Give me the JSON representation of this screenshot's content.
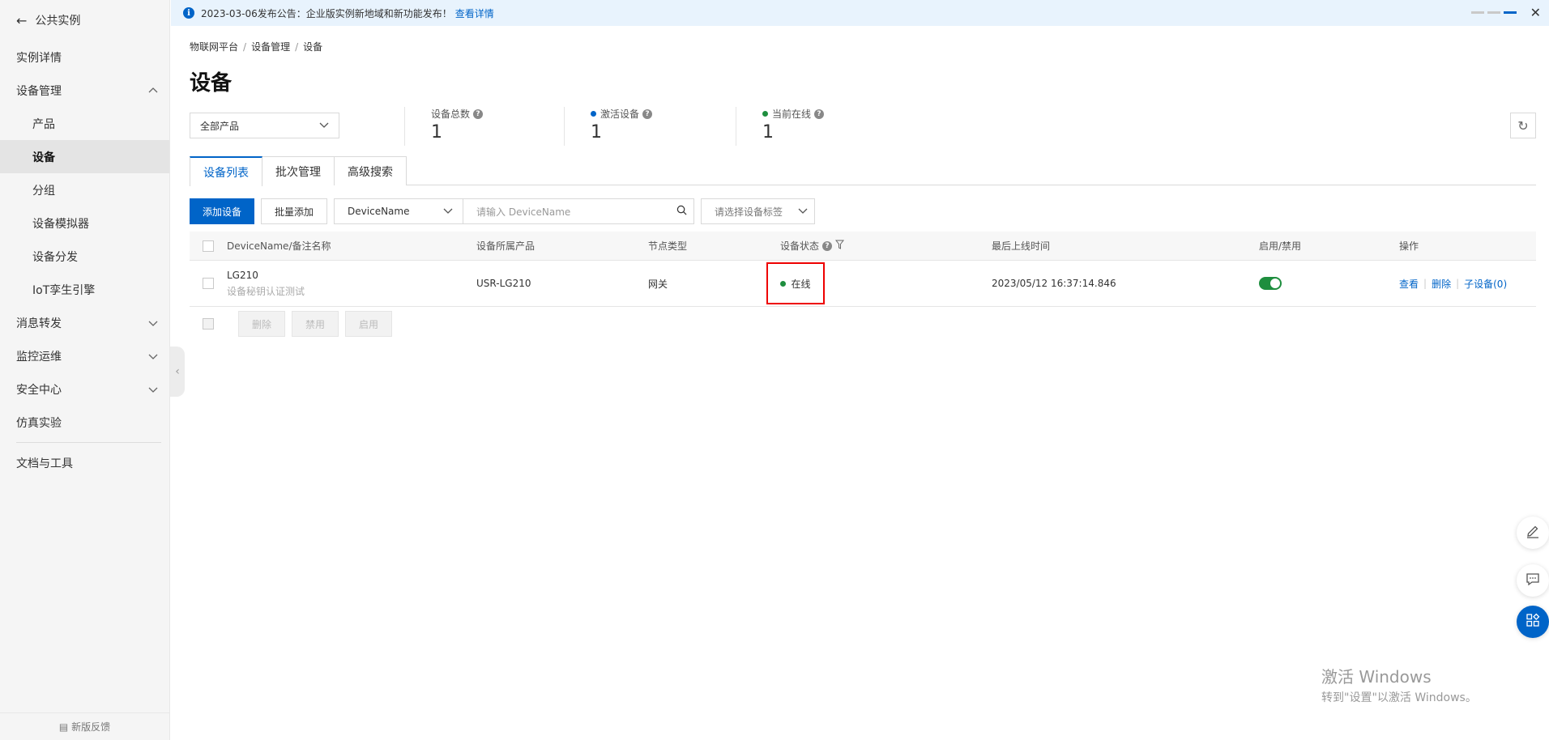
{
  "sidebar": {
    "back_label": "公共实例",
    "items": [
      {
        "label": "实例详情"
      },
      {
        "label": "设备管理"
      },
      {
        "label": "产品"
      },
      {
        "label": "设备"
      },
      {
        "label": "分组"
      },
      {
        "label": "设备模拟器"
      },
      {
        "label": "设备分发"
      },
      {
        "label": "IoT孪生引擎"
      },
      {
        "label": "消息转发"
      },
      {
        "label": "监控运维"
      },
      {
        "label": "安全中心"
      },
      {
        "label": "仿真实验"
      },
      {
        "label": "文档与工具"
      }
    ],
    "feedback_label": "新版反馈"
  },
  "announcement": {
    "text": "2023-03-06发布公告：企业版实例新地域和新功能发布！",
    "link": "查看详情"
  },
  "breadcrumb": [
    "物联网平台",
    "设备管理",
    "设备"
  ],
  "page_title": "设备",
  "product_select": "全部产品",
  "stats": [
    {
      "label": "设备总数",
      "value": "1",
      "dot_color": ""
    },
    {
      "label": "激活设备",
      "value": "1",
      "dot_color": "#0064c8"
    },
    {
      "label": "当前在线",
      "value": "1",
      "dot_color": "#1e8e3e"
    }
  ],
  "tabs": [
    "设备列表",
    "批次管理",
    "高级搜索"
  ],
  "toolbar": {
    "add_device": "添加设备",
    "batch_add": "批量添加",
    "field_select": "DeviceName",
    "search_placeholder": "请输入 DeviceName",
    "tag_placeholder": "请选择设备标签"
  },
  "table": {
    "headers": [
      "DeviceName/备注名称",
      "设备所属产品",
      "节点类型",
      "设备状态",
      "最后上线时间",
      "启用/禁用",
      "操作"
    ],
    "rows": [
      {
        "device_name": "LG210",
        "note": "设备秘钥认证测试",
        "product": "USR-LG210",
        "node_type": "网关",
        "status": "在线",
        "last_online": "2023/05/12 16:37:14.846",
        "enabled": true,
        "actions": [
          "查看",
          "删除",
          "子设备(0)"
        ]
      }
    ]
  },
  "bulk_actions": [
    "删除",
    "禁用",
    "启用"
  ],
  "watermark": {
    "title": "激活 Windows",
    "subtitle": "转到\"设置\"以激活 Windows。"
  },
  "colors": {
    "primary": "#0064c8",
    "online": "#1e8e3e",
    "highlight": "#e00000"
  }
}
